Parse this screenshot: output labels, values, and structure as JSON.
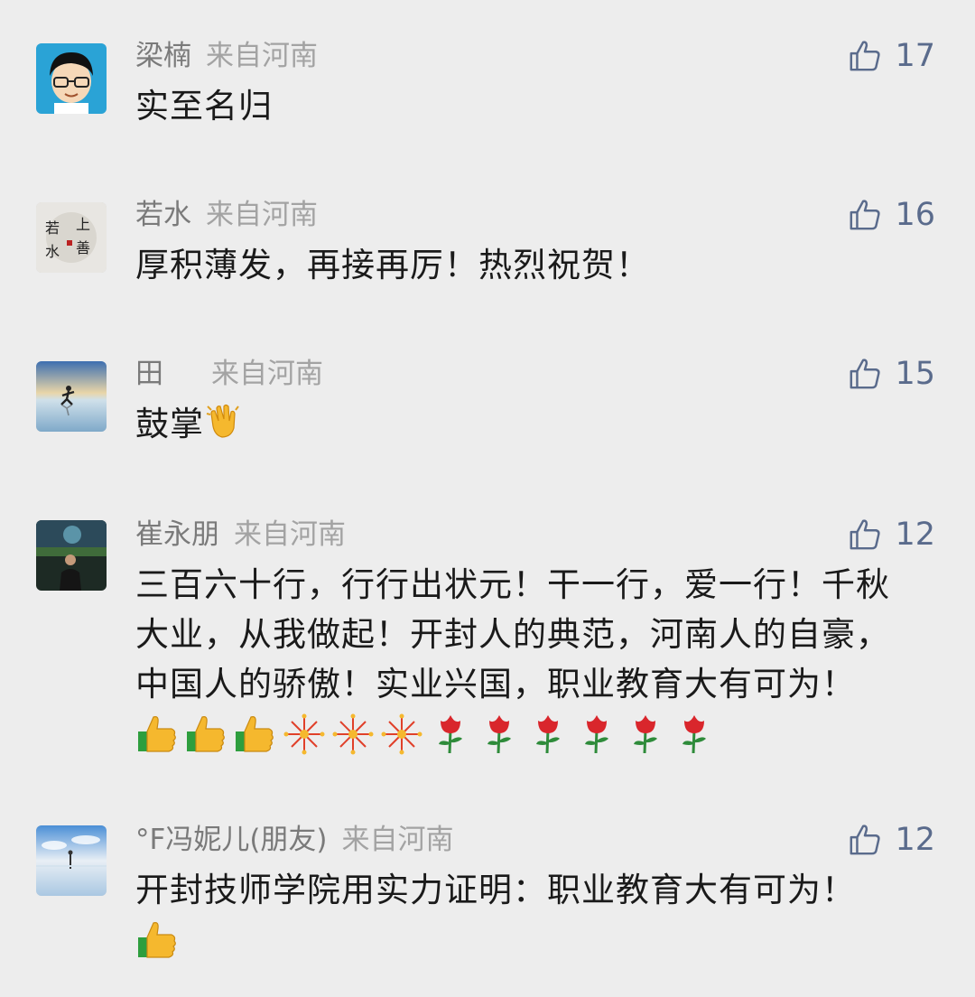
{
  "comments": [
    {
      "name": "梁楠",
      "location": "来自河南",
      "likes": "17",
      "text": "实至名归",
      "avatar_icon": "cartoon-boy-glasses-avatar"
    },
    {
      "name": "若水",
      "location": "来自河南",
      "likes": "16",
      "text": "厚积薄发，再接再厉！热烈祝贺！",
      "avatar_icon": "calligraphy-avatar",
      "avatar_text": "若上水善"
    },
    {
      "name": "田",
      "location": "来自河南",
      "likes": "15",
      "text": "鼓掌",
      "avatar_icon": "runner-sunset-avatar",
      "emoji": "clapping-hands"
    },
    {
      "name": "崔永朋",
      "location": "来自河南",
      "likes": "12",
      "text_lines": [
        "三百六十行，行行出状元！干一行，爱一行！千秋",
        "大业，从我做起！开封人的典范，河南人的自豪，",
        "中国人的骄傲！实业兴国，职业教育大有可为！"
      ],
      "emojis": [
        "thumbs-up",
        "thumbs-up",
        "thumbs-up",
        "fireworks",
        "fireworks",
        "fireworks",
        "rose",
        "rose",
        "rose",
        "rose",
        "rose",
        "rose"
      ],
      "avatar_icon": "night-photo-avatar"
    },
    {
      "name": "°F冯妮儿(朋友)",
      "location": "来自河南",
      "likes": "12",
      "text": "开封技师学院用实力证明：职业教育大有可为！",
      "emojis": [
        "thumbs-up"
      ],
      "avatar_icon": "beach-sky-avatar"
    }
  ],
  "colors": {
    "background": "#ededed",
    "name": "#7a7a7a",
    "location": "#a3a3a3",
    "like": "#5a6b8c",
    "text": "#1a1a1a"
  }
}
